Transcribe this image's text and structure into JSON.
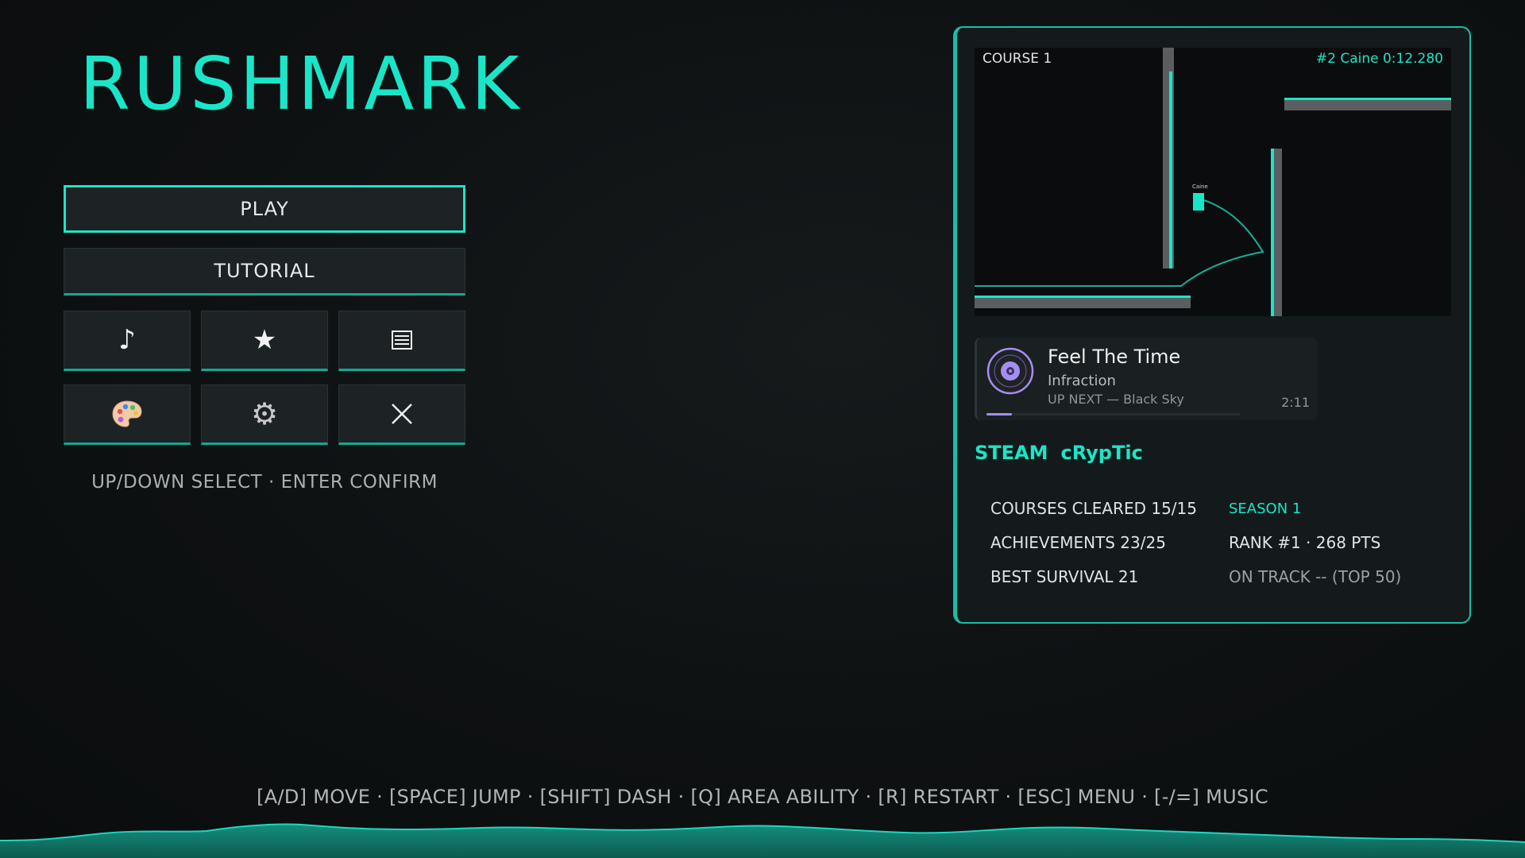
{
  "game": {
    "title": "RUSHMARK"
  },
  "menu": {
    "play_label": "PLAY",
    "tutorial_label": "TUTORIAL",
    "icon_buttons": [
      "music-note-icon",
      "star-icon",
      "list-icon",
      "palette-icon",
      "gear-icon",
      "close-icon"
    ],
    "hint": "UP/DOWN SELECT · ENTER CONFIRM"
  },
  "preview": {
    "course_label": "COURSE 1",
    "record": "#2  Caine  0:12.280",
    "ghost_name": "Caine"
  },
  "music": {
    "song": "Feel The Time",
    "artist": "Infraction",
    "up_next": "UP NEXT — Black Sky",
    "duration": "2:11",
    "progress_fraction": 0.1
  },
  "profile": {
    "platform": "STEAM",
    "username": "cRypTic"
  },
  "stats": {
    "courses_cleared": "COURSES CLEARED  15/15",
    "achievements": "ACHIEVEMENTS  23/25",
    "best_survival": "BEST SURVIVAL  21",
    "season": "SEASON 1",
    "rank": "RANK  #1  ·  268 PTS",
    "on_track": "ON TRACK  --  (TOP 50)"
  },
  "controls_hint": "[A/D] MOVE · [SPACE] JUMP · [SHIFT] DASH · [Q] AREA ABILITY · [R] RESTART · [ESC] MENU · [-/=] MUSIC",
  "colors": {
    "accent": "#19e6c8",
    "background": "#0e1112",
    "music_accent": "#a58ef2"
  }
}
